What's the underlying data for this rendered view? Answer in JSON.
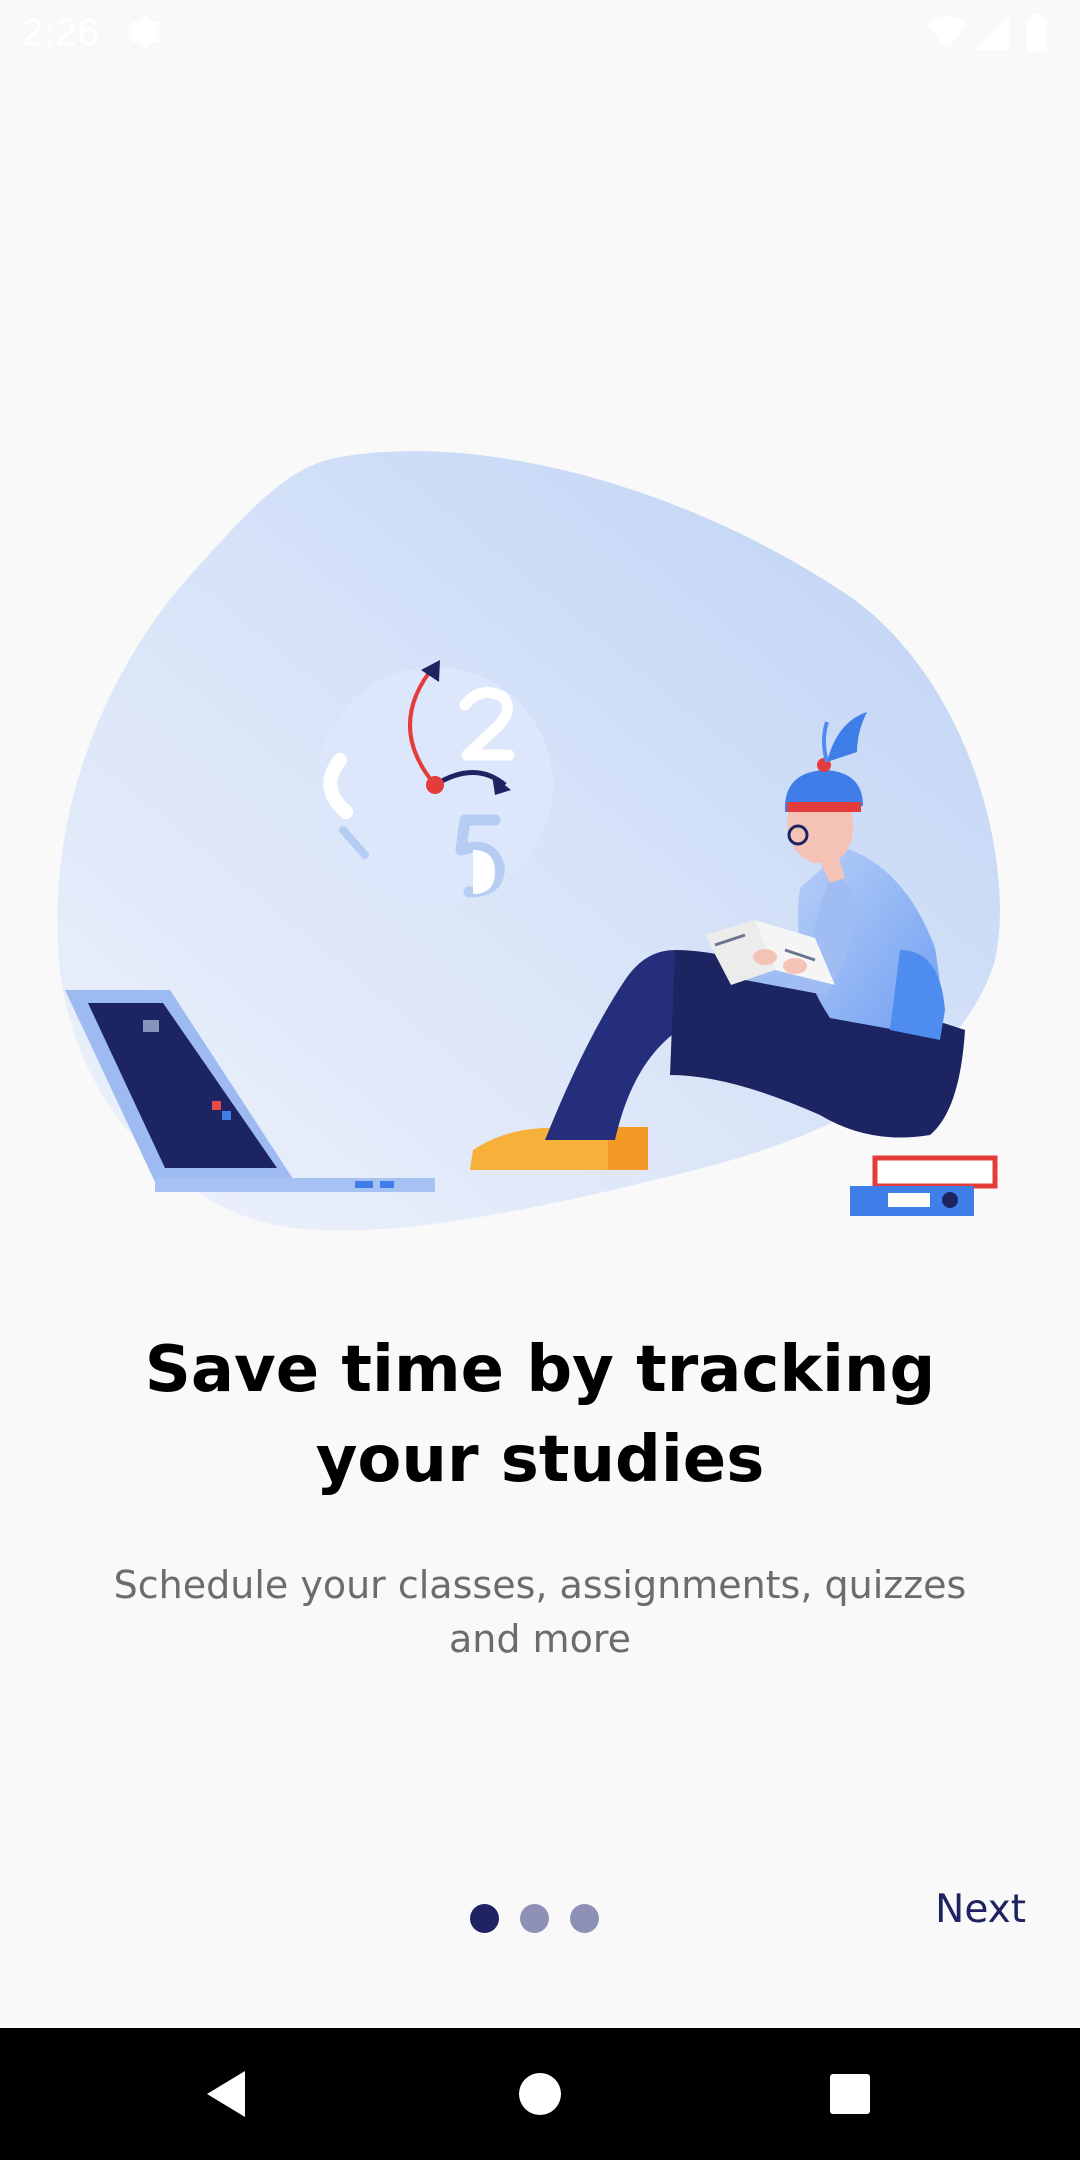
{
  "status_bar": {
    "time": "2:26",
    "icons": [
      "settings-gear-icon",
      "wifi-icon",
      "signal-icon",
      "battery-icon"
    ]
  },
  "onboarding": {
    "illustration": "person-studying-with-laptop-and-clock-illustration",
    "title": "Save time by tracking\nyour studies",
    "subtitle": "Schedule your classes, assignments, quizzes\nand more",
    "page_indicator": {
      "total": 3,
      "current": 1
    },
    "next_label": "Next"
  },
  "nav_bar": {
    "buttons": [
      "back-icon",
      "home-icon",
      "recents-icon"
    ]
  },
  "colors": {
    "background": "#f9f9f9",
    "accent_navy": "#1f2361",
    "dot_inactive": "#8e91b5",
    "subtitle_gray": "#6c6c6c"
  }
}
